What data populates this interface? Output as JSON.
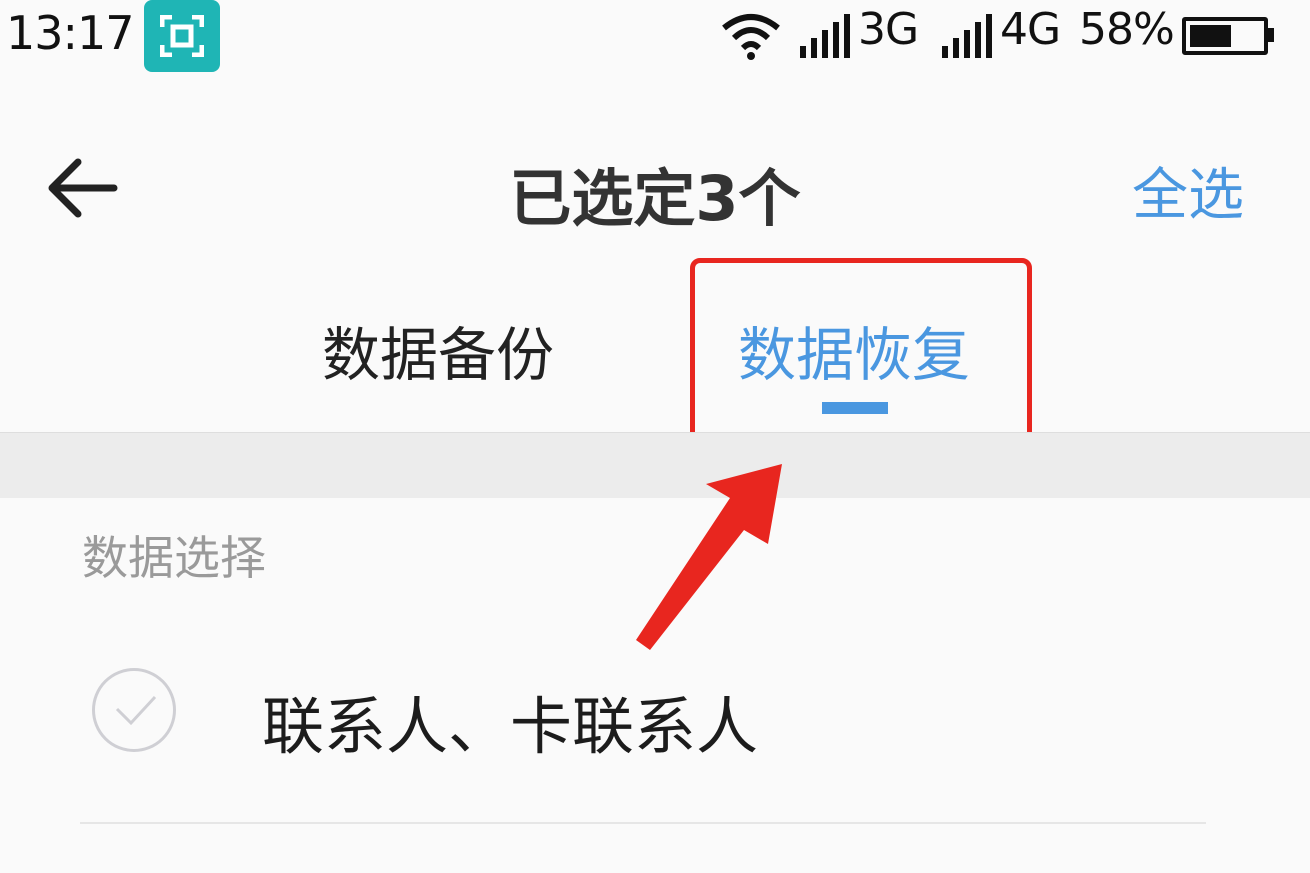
{
  "status_bar": {
    "time": "13:17",
    "network_1": "3G",
    "network_2": "4G",
    "battery_percent_text": "58%",
    "battery_level": 0.58,
    "icons": [
      "screenshot-scan-icon",
      "wifi-icon",
      "signal-icon",
      "signal-icon",
      "battery-icon"
    ]
  },
  "header": {
    "title": "已选定3个",
    "select_all_label": "全选",
    "back_icon": "back-arrow-icon"
  },
  "tabs": [
    {
      "label": "数据备份",
      "active": false
    },
    {
      "label": "数据恢复",
      "active": true
    }
  ],
  "section": {
    "label": "数据选择",
    "items": [
      {
        "label": "联系人、卡联系人",
        "checked": false
      }
    ]
  },
  "colors": {
    "accent": "#4a97e0",
    "annotation": "#e8261f",
    "scan_badge": "#1fb5b5"
  }
}
